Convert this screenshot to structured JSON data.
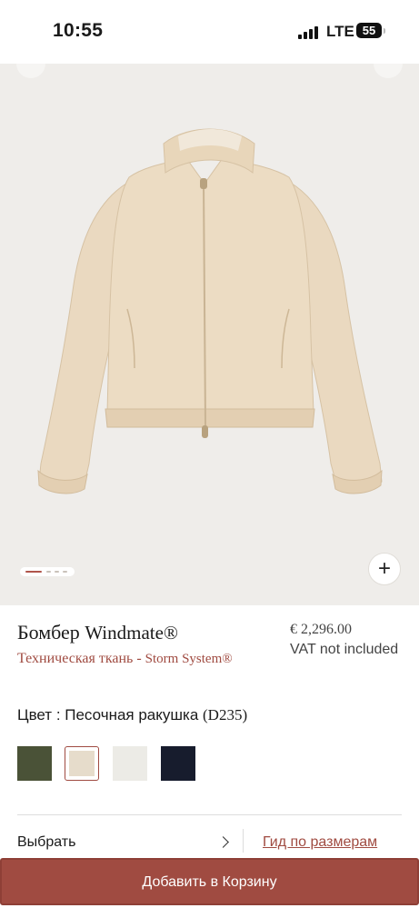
{
  "status_bar": {
    "time": "10:55",
    "network": "LTE",
    "battery": "55"
  },
  "gallery": {
    "zoom_symbol": "+",
    "pager": {
      "total": 4,
      "active_index": 0
    },
    "background_color": "#efedea",
    "garment_color": "#ead9c0"
  },
  "product": {
    "name": "Бомбер",
    "brand_name": "Windmate®",
    "fabric": "Техническая ткань",
    "separator": "-",
    "system": "Storm System®",
    "price": "€ 2,296.00",
    "vat_note": "VAT not included"
  },
  "color": {
    "label": "Цвет : Песочная ракушка",
    "code": "(D235)",
    "swatches": [
      {
        "name": "olive",
        "hex": "#4a5237",
        "selected": false
      },
      {
        "name": "sand-shell",
        "hex": "#e6dccb",
        "selected": true
      },
      {
        "name": "off-white",
        "hex": "#ecebe6",
        "selected": false
      },
      {
        "name": "navy",
        "hex": "#171c2d",
        "selected": false
      }
    ]
  },
  "size": {
    "select_label": "Выбрать",
    "guide_label": "Гид по размерам"
  },
  "cart": {
    "add_label": "Добавить в Корзину"
  },
  "colors": {
    "accent": "#a04b41"
  }
}
